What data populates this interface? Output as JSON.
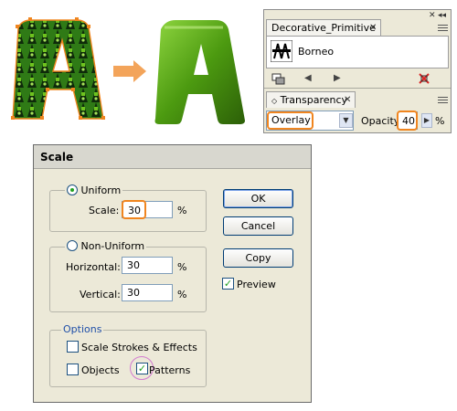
{
  "decorative_panel": {
    "tab_label": "Decorative_Primitive",
    "swatch_name": "Borneo",
    "close_glyph": "✕"
  },
  "transparency_panel": {
    "tab_label": "Transparency",
    "tab_prefix": "◇",
    "close_glyph": "✕",
    "blend_mode": "Overlay",
    "opacity_label": "Opacity:",
    "opacity_value": "40",
    "opacity_unit": "%"
  },
  "scale_dialog": {
    "title": "Scale",
    "uniform_label": "Uniform",
    "scale_label": "Scale:",
    "scale_value": "30",
    "non_uniform_label": "Non-Uniform",
    "horizontal_label": "Horizontal:",
    "horizontal_value": "30",
    "vertical_label": "Vertical:",
    "vertical_value": "30",
    "percent": "%",
    "options_label": "Options",
    "scale_strokes_label": "Scale Strokes & Effects",
    "objects_label": "Objects",
    "patterns_label": "Patterns",
    "ok_label": "OK",
    "cancel_label": "Cancel",
    "copy_label": "Copy",
    "preview_label": "Preview",
    "uniform_selected": true,
    "preview_checked": true,
    "patterns_checked": true,
    "objects_checked": false,
    "scale_strokes_checked": false
  },
  "colors": {
    "highlight": "#f0851f",
    "pink_highlight": "#d27ad0",
    "green": "#4c9a10",
    "arrow": "#f3a45a"
  },
  "icons": [
    "pattern-swatch-icon",
    "swatch-library-icon",
    "prev-arrow-icon",
    "next-arrow-icon",
    "delete-swatch-icon",
    "panel-menu-icon",
    "close-icon",
    "dropdown-arrow-icon",
    "right-arrow-icon"
  ]
}
